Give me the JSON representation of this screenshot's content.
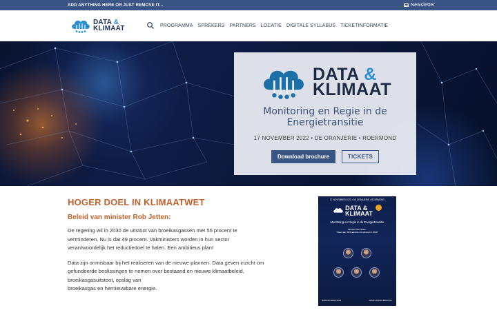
{
  "topbar": {
    "announcement": "ADD ANYTHING HERE OR JUST REMOVE IT...",
    "newsletter_label": "Newsletter"
  },
  "logo": {
    "line1": "DATA",
    "amp": "&",
    "line2": "KLIMAAT"
  },
  "nav": {
    "items": [
      "PROGRAMMA",
      "SPREKERS",
      "PARTNERS",
      "LOCATIE",
      "DIGITALE SYLLABUS",
      "TICKETINFORMATIE"
    ]
  },
  "hero": {
    "subtitle_line1": "Monitoring en Regie in de",
    "subtitle_line2": "Energietransitie",
    "meta": "17 NOVEMBER 2022 • DE ORANJERIE • ROERMOND",
    "download_label": "Download brochure",
    "tickets_label": "TICKETS"
  },
  "content": {
    "heading": "HOGER DOEL IN KLIMAATWET",
    "subheading": "Beleid van minister Rob Jetten:",
    "paragraph1_lines": [
      "De regering wil in 2030 de uitstoot van broeikasgassen met 55 procent te",
      "verminderen. Nu is dat 49 procent. Vakministers worden in hun sector",
      "verantwoordelijk het reductiedoel te halen. Een ambitieus plan!"
    ],
    "paragraph2_lines": [
      "Data zijn onmisbaar bij het realiseren van de nieuwe plannen. Data geven inzicht om",
      "gefundeerde beslissingen te nemen over bestaand en nieuwe klimaatbeleid,",
      "broeikasgasuitstoot, opslag van",
      "broeikasgas en hernieuwbare energie."
    ]
  },
  "poster": {
    "date": "17 NOVEMBER 2022 • DE ORANJERIE • ROERMOND",
    "title": "Monitoring en Regie in de Energietransitie",
    "quote_line1": "Minister Rob Jetten:",
    "quote_line2": "\"Meer dan 49% reductie co2-uitstoot in 2030\"",
    "url": "WWW.DATAKLIMAAT.NL",
    "footer": "EUROFORUM 2022"
  },
  "colors": {
    "topbar": "#3a5585",
    "accent_orange": "#c0622d",
    "logo_blue": "#2a8fd1",
    "logo_dark": "#1d3253"
  }
}
